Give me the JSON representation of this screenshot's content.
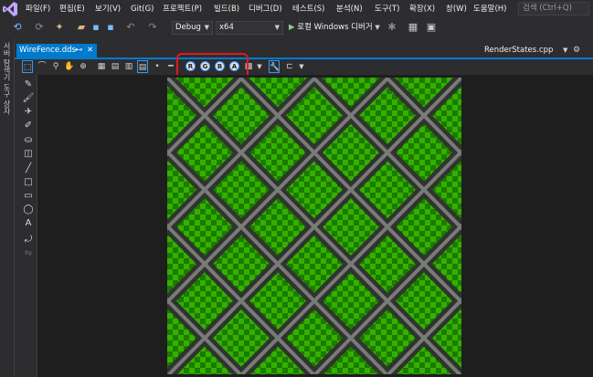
{
  "menu": {
    "file": "파일(F)",
    "edit": "편집(E)",
    "view": "보기(V)",
    "git": "Git(G)",
    "project": "프로젝트(P)",
    "build": "빌드(B)",
    "debug": "디버그(D)",
    "test": "테스트(S)",
    "analyze": "분석(N)",
    "tools": "도구(T)",
    "extensions": "확장(X)",
    "window": "창(W)",
    "help": "도움말(H)"
  },
  "search": {
    "placeholder": "검색 (Ctrl+Q)"
  },
  "toolbar": {
    "configuration": "Debug",
    "platform": "x64",
    "run_debugger": "로컬 Windows 디버거"
  },
  "side_panel": {
    "label": "서버 탐색기  도구 상자"
  },
  "tabs": {
    "active": "WireFence.dds",
    "right": "RenderStates.cpp"
  },
  "channels": [
    "R",
    "G",
    "B",
    "A"
  ],
  "colors": {
    "accent": "#007acc",
    "highlight_box": "#e01b1b",
    "checker_light": "#33b000",
    "checker_dark": "#1c7a00"
  },
  "icons": {
    "logo": "visual-studio-logo",
    "play": "play-icon"
  }
}
